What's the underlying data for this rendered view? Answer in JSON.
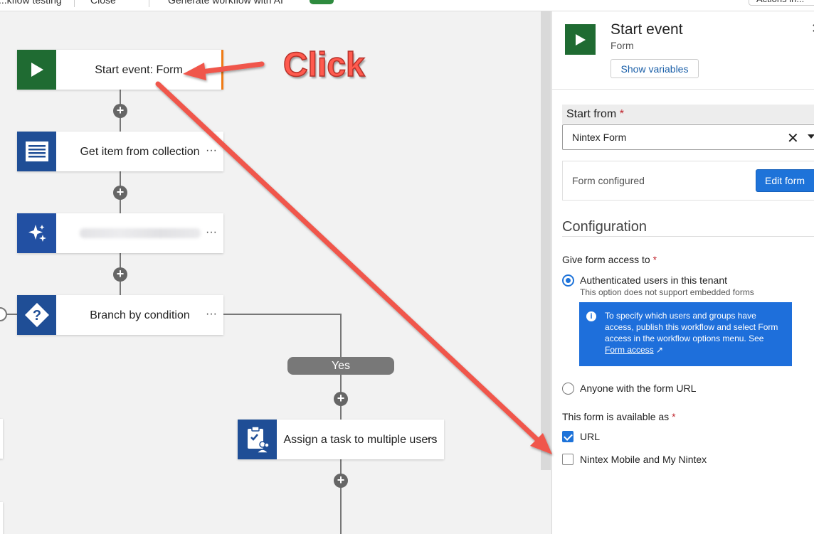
{
  "topbar": {
    "testing_label": "...kflow testing",
    "close_label": "Close",
    "generate_label": "Generate workflow with AI",
    "actions_label": "Actions in..."
  },
  "canvas": {
    "nodes": [
      {
        "label": "Start event: Form",
        "icon": "play-icon"
      },
      {
        "label": "Get item from collection",
        "icon": "document-list-icon",
        "menu": "···"
      },
      {
        "label": "",
        "icon": "sparkle-icon",
        "menu": "···"
      },
      {
        "label": "Branch by condition",
        "icon": "question-diamond-icon",
        "menu": "···"
      },
      {
        "label": "Assign a task to multiple users",
        "icon": "clipboard-users-icon",
        "menu": "···"
      }
    ],
    "branch_label": "Yes"
  },
  "panel": {
    "title": "Start event",
    "subtitle": "Form",
    "show_variables": "Show variables",
    "start_from_label": "Start from",
    "start_from_value": "Nintex Form",
    "form_configured": "Form configured",
    "edit_form": "Edit form",
    "configuration_title": "Configuration",
    "access_label": "Give form access to",
    "access_options": [
      {
        "label": "Authenticated users in this tenant",
        "help": "This option does not support embedded forms",
        "selected": true
      },
      {
        "label": "Anyone with the form URL",
        "selected": false
      }
    ],
    "info_text": "To specify which users and groups have access, publish this workflow and select Form access in the workflow options menu. See",
    "info_link": "Form access",
    "available_label": "This form is available as",
    "available_options": [
      {
        "label": "URL",
        "checked": true
      },
      {
        "label": "Nintex Mobile and My Nintex",
        "checked": false
      }
    ],
    "required_marker": "*"
  },
  "annotation": {
    "click_label": "Click",
    "color": "#f0574b"
  },
  "colors": {
    "start_green": "#1f6b32",
    "action_blue": "#1f4e96",
    "accent_orange": "#f07b16",
    "primary_blue": "#1e73d9"
  }
}
